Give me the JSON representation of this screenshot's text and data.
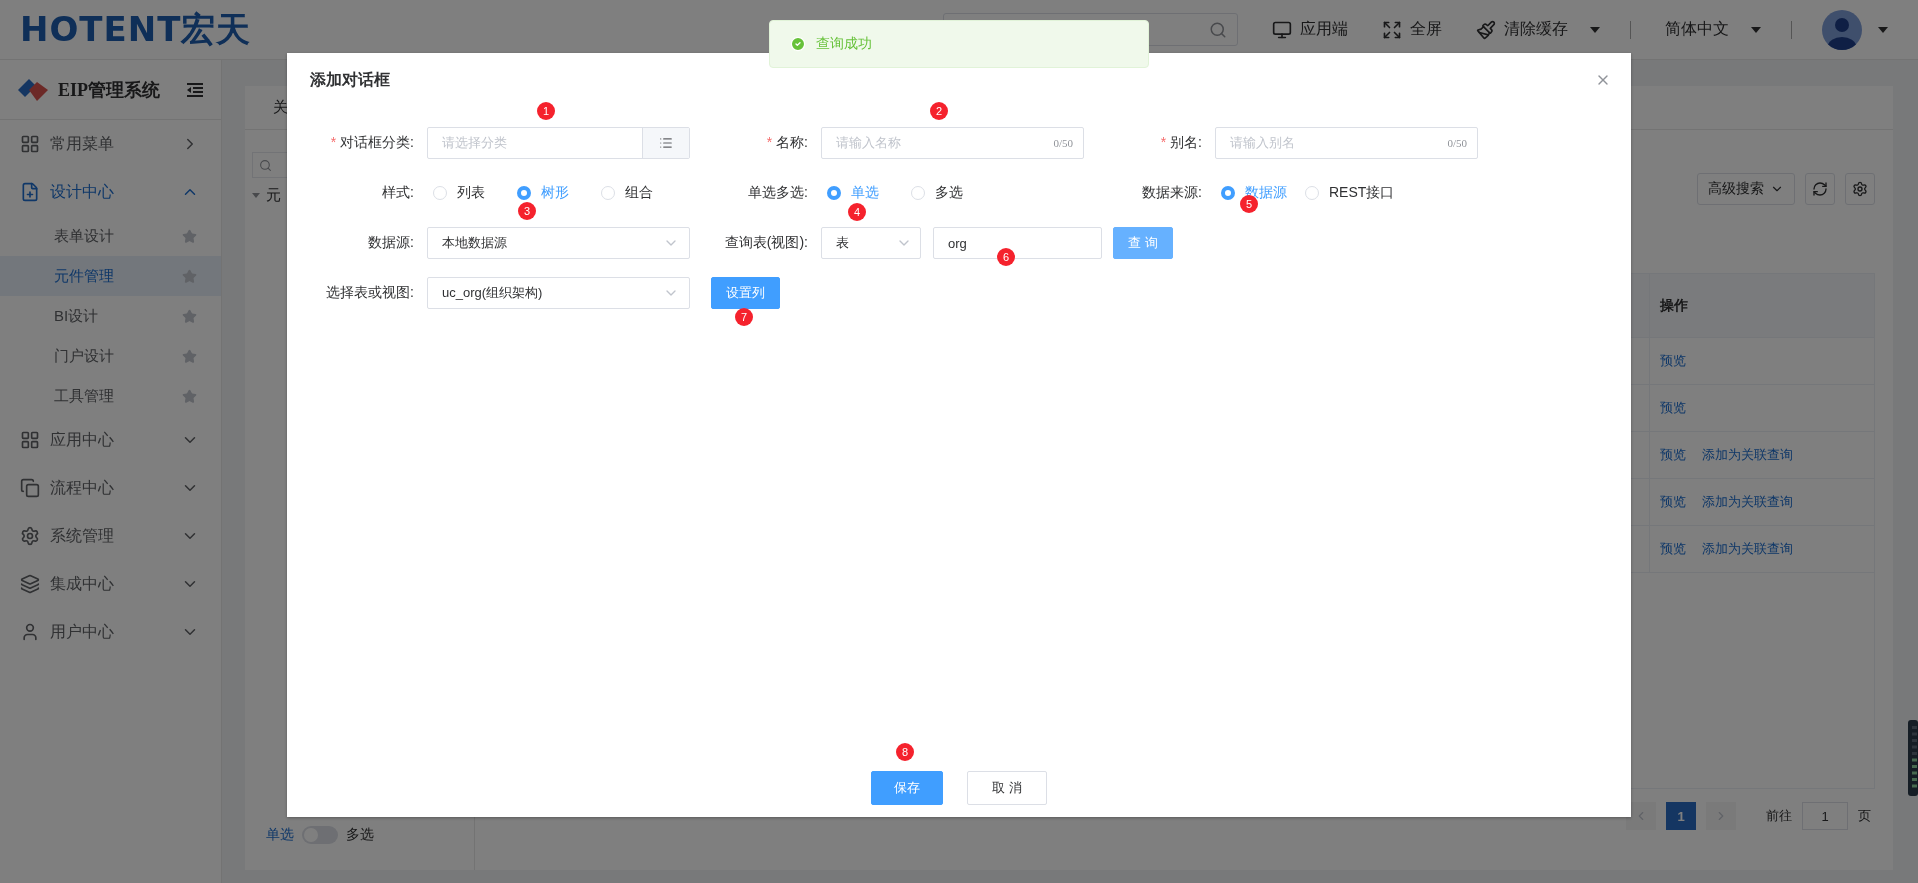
{
  "header": {
    "logo": "HOTENT宏天",
    "actions": [
      {
        "label": "应用端",
        "dropdown": false
      },
      {
        "label": "全屏",
        "dropdown": false
      },
      {
        "label": "清除缓存",
        "dropdown": true
      }
    ],
    "language": "简体中文"
  },
  "sidebar": {
    "title": "EIP管理系统",
    "items": [
      {
        "label": "常用菜单",
        "kind": "link",
        "expanded": false
      },
      {
        "label": "设计中心",
        "kind": "group",
        "expanded": true,
        "children": [
          {
            "label": "表单设计",
            "selected": false
          },
          {
            "label": "元件管理",
            "selected": true
          },
          {
            "label": "BI设计",
            "selected": false
          },
          {
            "label": "门户设计",
            "selected": false
          },
          {
            "label": "工具管理",
            "selected": false
          }
        ]
      },
      {
        "label": "应用中心",
        "kind": "group",
        "expanded": false
      },
      {
        "label": "流程中心",
        "kind": "group",
        "expanded": false
      },
      {
        "label": "系统管理",
        "kind": "group",
        "expanded": false
      },
      {
        "label": "集成中心",
        "kind": "group",
        "expanded": false
      },
      {
        "label": "用户中心",
        "kind": "group",
        "expanded": false
      }
    ]
  },
  "content": {
    "tab": "关",
    "tree_node": "元",
    "toggle": {
      "left": "单选",
      "right": "多选",
      "on": false
    },
    "toolbar": {
      "search_button": "高级搜索"
    },
    "table": {
      "columns": [
        "操作"
      ],
      "rows": [
        {
          "actions": [
            "预览"
          ]
        },
        {
          "actions": [
            "预览"
          ]
        },
        {
          "actions": [
            "预览",
            "添加为关联查询"
          ]
        },
        {
          "actions": [
            "预览",
            "添加为关联查询"
          ]
        },
        {
          "actions": [
            "预览",
            "添加为关联查询"
          ]
        }
      ]
    },
    "pagination": {
      "pages": [
        {
          "label": "1",
          "selected": true
        }
      ],
      "goto_label": "前往",
      "goto_value": "1",
      "unit": "页"
    }
  },
  "toast": {
    "message": "查询成功"
  },
  "dialog": {
    "title": "添加对话框",
    "rows": [
      [
        {
          "kind": "input",
          "label": "对话框分类:",
          "mark": "*",
          "placeholder": "请选择分类",
          "picker": true
        },
        {
          "kind": "input",
          "label": "名称:",
          "mark": "*",
          "placeholder": "请输入名称",
          "counter": "0/50"
        },
        {
          "kind": "input",
          "label": "别名:",
          "mark": "*",
          "placeholder": "请输入别名",
          "counter": "0/50"
        }
      ],
      [
        {
          "kind": "radio",
          "label": "样式:",
          "options": [
            {
              "label": "列表",
              "selected": false
            },
            {
              "label": "树形",
              "selected": true
            },
            {
              "label": "组合",
              "selected": false
            }
          ]
        },
        {
          "kind": "radio",
          "label": "单选多选:",
          "options": [
            {
              "label": "单选",
              "selected": true
            },
            {
              "label": "多选",
              "selected": false
            }
          ]
        },
        {
          "kind": "radio",
          "label": "数据来源:",
          "options": [
            {
              "label": "数据源",
              "selected": true
            },
            {
              "label": "REST接口",
              "selected": false
            }
          ]
        }
      ],
      [
        {
          "kind": "select",
          "label": "数据源:",
          "value": "本地数据源"
        },
        {
          "kind": "query",
          "label": "查询表(视图):",
          "select_value": "表",
          "input_value": "org",
          "button": "查 询"
        }
      ],
      [
        {
          "kind": "select",
          "label": "选择表或视图:",
          "value": "uc_org(组织架构)",
          "button": "设置列"
        }
      ]
    ],
    "buttons": [
      {
        "label": "保存",
        "primary": true
      },
      {
        "label": "取 消",
        "primary": false
      }
    ],
    "markers": [
      "1",
      "2",
      "3",
      "4",
      "5",
      "6",
      "7",
      "8"
    ]
  }
}
